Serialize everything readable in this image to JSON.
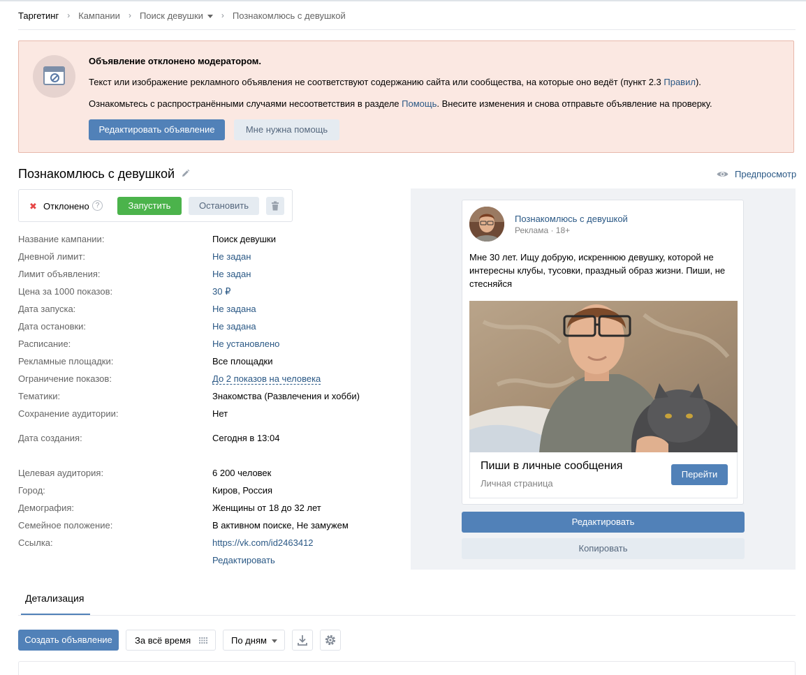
{
  "breadcrumbs": {
    "items": [
      "Таргетинг",
      "Кампании",
      "Поиск девушки",
      "Познакомлюсь с девушкой"
    ]
  },
  "alert": {
    "title": "Объявление отклонено модератором.",
    "p1_text": "Текст или изображение рекламного объявления не соответствуют содержанию сайта или сообщества, на которые оно ведёт (пункт 2.3 ",
    "p1_link": "Правил",
    "p1_end": ").",
    "p2_text": "Ознакомьтесь с распространёнными случаями несоответствия в разделе ",
    "p2_link": "Помощь",
    "p2_end": ". Внесите изменения и снова отправьте объявление на проверку.",
    "edit_button": "Редактировать объявление",
    "help_button": "Мне нужна помощь"
  },
  "ad": {
    "title": "Познакомлюсь с девушкой",
    "preview_link": "Предпросмотр"
  },
  "status": {
    "mark": "✖",
    "label": "Отклонено",
    "help": "?",
    "run_button": "Запустить",
    "stop_button": "Остановить"
  },
  "details": [
    {
      "key": "Название кампании:",
      "value": "Поиск девушки"
    },
    {
      "key": "Дневной лимит:",
      "value": "Не задан"
    },
    {
      "key": "Лимит объявления:",
      "value": "Не задан"
    },
    {
      "key": "Цена за 1000 показов:",
      "value": "30 ₽"
    },
    {
      "key": "Дата запуска:",
      "value": "Не задана"
    },
    {
      "key": "Дата остановки:",
      "value": "Не задана"
    },
    {
      "key": "Расписание:",
      "value": "Не установлено"
    },
    {
      "key": "Рекламные площадки:",
      "value": "Все площадки"
    },
    {
      "key": "Ограничение показов:",
      "value": "До 2 показов на человека"
    },
    {
      "key": "Тематики:",
      "value": "Знакомства (Развлечения и хобби)"
    },
    {
      "key": "Сохранение аудитории:",
      "value": "Нет"
    },
    {
      "key": "Дата создания:",
      "value": "Сегодня в 13:04"
    },
    {
      "key": "Целевая аудитория:",
      "value": "6 200 человек"
    },
    {
      "key": "Город:",
      "value": "Киров, Россия"
    },
    {
      "key": "Демография:",
      "value": "Женщины от 18 до 32 лет"
    },
    {
      "key": "Семейное положение:",
      "value": "В активном поиске, Не замужем"
    },
    {
      "key": "Ссылка:",
      "value": "https://vk.com/id2463412"
    },
    {
      "key": "",
      "value": "Редактировать"
    }
  ],
  "preview": {
    "name": "Познакомлюсь с девушкой",
    "meta": "Реклама · 18+",
    "text": "Мне 30 лет. Ищу добрую, искреннюю девушку, которой не интересны клубы, тусовки, праздный образ жизни. Пиши, не стесняйся",
    "cta_title": "Пиши в личные сообщения",
    "cta_sub": "Личная страница",
    "cta_button": "Перейти",
    "edit_button": "Редактировать",
    "copy_button": "Копировать"
  },
  "tabs": {
    "details": "Детализация"
  },
  "toolbar": {
    "create_button": "Создать объявление",
    "period": "За всё время",
    "grouping": "По дням"
  },
  "colors": {
    "accent": "#5181b8",
    "link": "#2a5885",
    "alert_bg": "#fbe8e2",
    "success": "#4bb34b",
    "reject": "#e64646"
  },
  "icons": [
    "pencil-icon",
    "eye-icon",
    "question-icon",
    "trash-icon",
    "calendar-grid-icon",
    "chevron-down-icon",
    "download-icon",
    "gear-icon",
    "banned-page-icon"
  ]
}
